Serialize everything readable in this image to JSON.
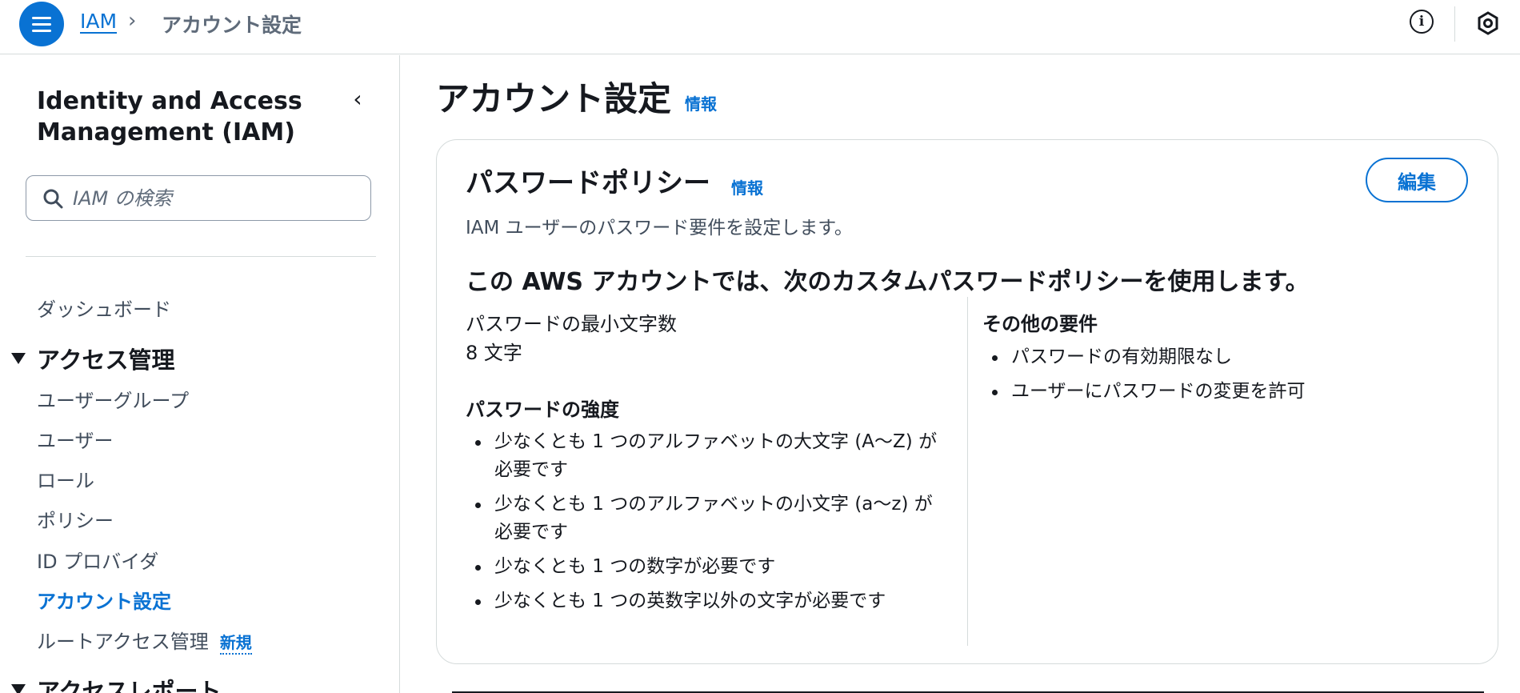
{
  "topbar": {
    "breadcrumb_root": "IAM",
    "breadcrumb_separator": "›",
    "breadcrumb_current": "アカウント設定",
    "icons": [
      "menu-icon",
      "info-icon",
      "settings-icon"
    ]
  },
  "sidebar": {
    "title": "Identity and Access Management (IAM)",
    "collapse_glyph": "‹",
    "search_placeholder": "IAM の検索",
    "items": {
      "dashboard": "ダッシュボード",
      "section_access": "アクセス管理",
      "user_groups": "ユーザーグループ",
      "users": "ユーザー",
      "roles": "ロール",
      "policies": "ポリシー",
      "id_providers": "ID プロバイダ",
      "account_settings": "アカウント設定",
      "root_access": "ルートアクセス管理",
      "root_access_badge": "新規",
      "section_reports": "アクセスレポート"
    }
  },
  "main": {
    "title": "アカウント設定",
    "info_label": "情報",
    "card": {
      "title": "パスワードポリシー",
      "info_label": "情報",
      "edit_label": "編集",
      "description": "IAM ユーザーのパスワード要件を設定します。",
      "heading": "この AWS アカウントでは、次のカスタムパスワードポリシーを使用します。",
      "min_length_label": "パスワードの最小文字数",
      "min_length_value": "8 文字",
      "strength_heading": "パスワードの強度",
      "strength_items": [
        "少なくとも 1 つのアルファベットの大文字 (A～Z) が必要です",
        "少なくとも 1 つのアルファベットの小文字 (a～z) が必要です",
        "少なくとも 1 つの数字が必要です",
        "少なくとも 1 つの英数字以外の文字が必要です"
      ],
      "other_heading": "その他の要件",
      "other_items": [
        "パスワードの有効期限なし",
        "ユーザーにパスワードの変更を許可"
      ]
    }
  },
  "colors": {
    "accent": "#0972d3",
    "text": "#16191f",
    "muted": "#5f6b7a",
    "border": "#d5dbdb"
  }
}
